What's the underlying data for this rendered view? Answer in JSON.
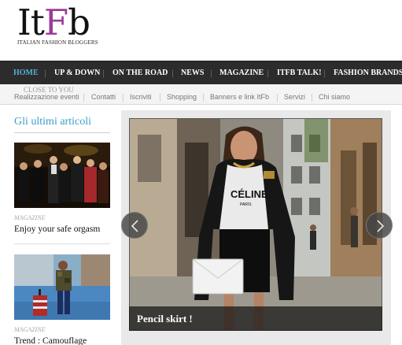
{
  "logo": {
    "mark_prefix": "It",
    "mark_accent": "F",
    "mark_suffix": "b",
    "tagline": "ITALIAN FASHION BLOGGERS"
  },
  "nav": {
    "items": [
      "HOME",
      "UP & DOWN",
      "ON THE ROAD",
      "NEWS",
      "MAGAZINE",
      "ITFB TALK!",
      "FASHION BRANDS"
    ],
    "active": "HOME"
  },
  "subnav": {
    "overlay_label": "CLOSE TO YOU",
    "items": [
      "Realizzazione eventi",
      "Contatti",
      "Iscriviti",
      "Shopping",
      "Banners e link ItFb",
      "Servizi",
      "Chi siamo"
    ]
  },
  "sidebar": {
    "title": "Gli ultimi articoli",
    "articles": [
      {
        "category": "MAGAZINE",
        "title": "Enjoy your safe orgasm"
      },
      {
        "category": "MAGAZINE",
        "title": "Trend : Camouflage"
      }
    ]
  },
  "slider": {
    "caption": "Pencil skirt !",
    "shirt_print": "CÉLINE",
    "shirt_sub": "PARIS",
    "prev_icon": "chevron-left-icon",
    "next_icon": "chevron-right-icon"
  },
  "colors": {
    "nav_bg": "#2c2c2c",
    "nav_active": "#52b3d6",
    "brand_purple": "#9c3a9b",
    "sidebar_title": "#3a9fc7"
  }
}
